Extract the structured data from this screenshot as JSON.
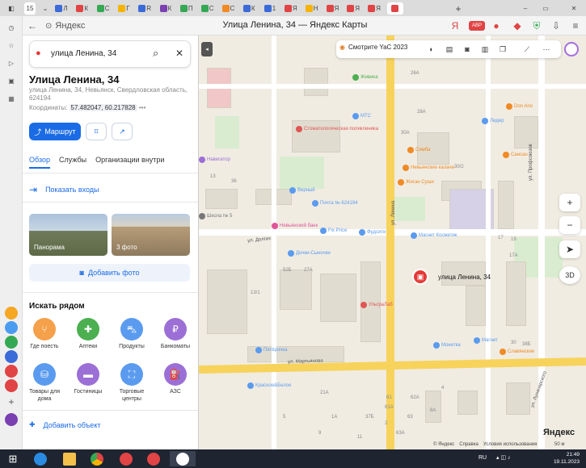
{
  "browser": {
    "tab_count": "15",
    "tabs": [
      {
        "label": "Л",
        "color": "#3a6bd8"
      },
      {
        "label": "К",
        "color": "#e04444"
      },
      {
        "label": "С",
        "color": "#35a853"
      },
      {
        "label": "Г",
        "color": "#f5b400"
      },
      {
        "label": "R",
        "color": "#3a6bd8"
      },
      {
        "label": "К",
        "color": "#7a3fb0"
      },
      {
        "label": "П",
        "color": "#35a853"
      },
      {
        "label": "С",
        "color": "#35a853"
      },
      {
        "label": "С",
        "color": "#f08a24"
      },
      {
        "label": "К",
        "color": "#3a6bd8"
      },
      {
        "label": "1",
        "color": "#3a6bd8"
      },
      {
        "label": "Я",
        "color": "#e04444"
      },
      {
        "label": "Н",
        "color": "#f5b400"
      },
      {
        "label": "Я",
        "color": "#e04444"
      },
      {
        "label": "Я",
        "color": "#e04444"
      },
      {
        "label": "Я",
        "color": "#e04444"
      },
      {
        "label": "",
        "color": "#e04444"
      }
    ],
    "url_text": "Яндекс",
    "page_title": "Улица Ленина, 34 — Яндекс Карты",
    "abp_label": "ABP"
  },
  "panel": {
    "search_value": "улица Ленина, 34",
    "title": "Улица Ленина, 34",
    "address": "улица Ленина, 34, Невьянск, Свердловская область, 624194",
    "coords_label": "Координаты:",
    "coords_value": "57.482047, 60.217828",
    "coords_more": "•••",
    "route_label": "Маршрут",
    "tabs": [
      "Обзор",
      "Службы",
      "Организации внутри"
    ],
    "show_entrances": "Показать входы",
    "photos": [
      {
        "label": "Панорама"
      },
      {
        "label": "3 фото"
      }
    ],
    "add_photo": "Добавить фото",
    "nearby_title": "Искать рядом",
    "categories": [
      {
        "label": "Где поесть",
        "color": "#f5a04a",
        "icon": "fork-knife-icon"
      },
      {
        "label": "Аптеки",
        "color": "#4caf50",
        "icon": "plus-icon"
      },
      {
        "label": "Продукты",
        "color": "#5b9bef",
        "icon": "basket-icon"
      },
      {
        "label": "Банкоматы",
        "color": "#9c6fd6",
        "icon": "ruble-icon"
      },
      {
        "label": "Товары для дома",
        "color": "#5b9bef",
        "icon": "bag-icon"
      },
      {
        "label": "Гостиницы",
        "color": "#9c6fd6",
        "icon": "bed-icon"
      },
      {
        "label": "Торговые центры",
        "color": "#5b9bef",
        "icon": "shopping-bag-icon"
      },
      {
        "label": "АЗС",
        "color": "#9c6fd6",
        "icon": "fuel-icon"
      }
    ],
    "add_object": "Добавить объект"
  },
  "map": {
    "promo": "Смотрите YaC 2023",
    "pin_label": "улица Ленина, 34",
    "zoom_in": "+",
    "zoom_out": "−",
    "btn_3d": "3D",
    "copyright": [
      "© Яндекс",
      "Справка",
      "Условия использования"
    ],
    "logo": "Яндекс",
    "scale": "50 м",
    "streets": [
      {
        "name": "ул. Ленина"
      },
      {
        "name": "ул. Мартьянова"
      },
      {
        "name": "ул. Долгих"
      },
      {
        "name": "ул. Профсоюзов"
      },
      {
        "name": "ул. Луначарского"
      }
    ],
    "pois": [
      {
        "name": "Живика",
        "color": "#4caf50"
      },
      {
        "name": "МТС",
        "color": "#5b9bef"
      },
      {
        "name": "Стоматологическая поликлиника",
        "color": "#e05555"
      },
      {
        "name": "Верный",
        "color": "#5b9bef"
      },
      {
        "name": "Почта № 624194",
        "color": "#5b9bef"
      },
      {
        "name": "Невьянский банк",
        "color": "#e05599"
      },
      {
        "name": "Fix Price",
        "color": "#5b9bef"
      },
      {
        "name": "Фудсити",
        "color": "#5b9bef"
      },
      {
        "name": "Дочки-Сыночки",
        "color": "#5b9bef"
      },
      {
        "name": "УльтраЛаб",
        "color": "#e05555"
      },
      {
        "name": "Магнит Косметик",
        "color": "#5b9bef"
      },
      {
        "name": "Пятёрочка",
        "color": "#5b9bef"
      },
      {
        "name": "Красное&Белое",
        "color": "#5b9bef"
      },
      {
        "name": "Монетка",
        "color": "#5b9bef"
      },
      {
        "name": "Магнит",
        "color": "#5b9bef"
      },
      {
        "name": "Лидер",
        "color": "#5b9bef"
      },
      {
        "name": "Don Ario",
        "color": "#f08a24"
      },
      {
        "name": "Симба",
        "color": "#f08a24"
      },
      {
        "name": "Невьянские калачи",
        "color": "#f08a24"
      },
      {
        "name": "Жиган Суши",
        "color": "#f08a24"
      },
      {
        "name": "Сансан",
        "color": "#f08a24"
      },
      {
        "name": "Навигатор",
        "color": "#9c6fd6"
      },
      {
        "name": "Школа № 5",
        "color": "#777777"
      },
      {
        "name": "Славянские",
        "color": "#f08a24"
      }
    ],
    "house_numbers": [
      "28A",
      "26A",
      "30A",
      "30/2",
      "17",
      "19",
      "17A",
      "13",
      "27A",
      "52Б",
      "13/1",
      "36",
      "37Б",
      "61",
      "61A",
      "62А",
      "63",
      "63А",
      "2",
      "4",
      "21А",
      "1А",
      "9",
      "11",
      "5",
      "8А",
      "38Б",
      "30"
    ]
  },
  "taskbar": {
    "lang": "RU",
    "time": "21:49",
    "date": "19.11.2023"
  }
}
